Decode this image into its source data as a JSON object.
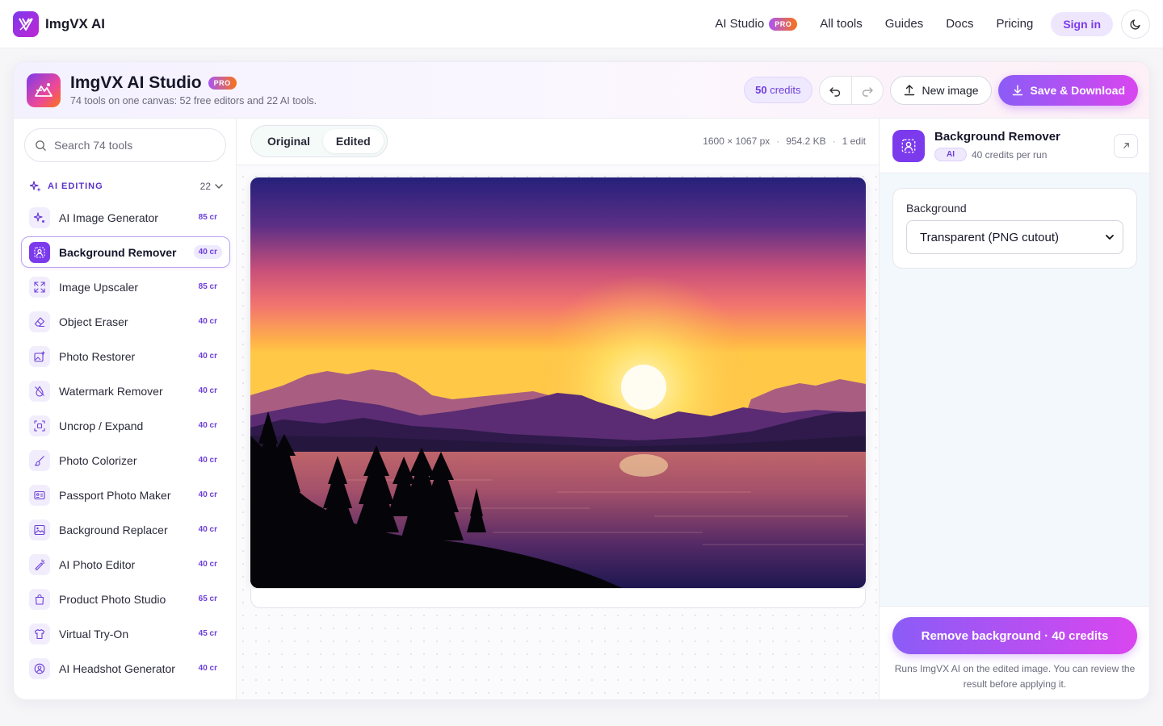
{
  "nav": {
    "brand": "ImgVX AI",
    "links": [
      {
        "label": "AI Studio",
        "badge": "PRO"
      },
      {
        "label": "All tools"
      },
      {
        "label": "Guides"
      },
      {
        "label": "Docs"
      },
      {
        "label": "Pricing"
      }
    ],
    "signin": "Sign in",
    "theme_icon": "moon-icon"
  },
  "studio": {
    "title": "ImgVX AI Studio",
    "badge": "PRO",
    "subtitle": "74 tools on one canvas: 52 free editors and 22 AI tools.",
    "credits_value": "50",
    "credits_label": "credits",
    "new_image": "New image",
    "save": "Save & Download"
  },
  "sidebar": {
    "search_placeholder": "Search 74 tools",
    "section": {
      "title": "AI EDITING",
      "count": "22"
    },
    "tools": [
      {
        "name": "AI Image Generator",
        "cost": "85 cr",
        "icon": "sparkles-icon"
      },
      {
        "name": "Background Remover",
        "cost": "40 cr",
        "icon": "person-cutout-icon",
        "active": true
      },
      {
        "name": "Image Upscaler",
        "cost": "85 cr",
        "icon": "expand-icon"
      },
      {
        "name": "Object Eraser",
        "cost": "40 cr",
        "icon": "eraser-icon"
      },
      {
        "name": "Photo Restorer",
        "cost": "40 cr",
        "icon": "image-plus-icon"
      },
      {
        "name": "Watermark Remover",
        "cost": "40 cr",
        "icon": "droplet-off-icon"
      },
      {
        "name": "Uncrop / Expand",
        "cost": "40 cr",
        "icon": "scan-icon"
      },
      {
        "name": "Photo Colorizer",
        "cost": "40 cr",
        "icon": "brush-icon"
      },
      {
        "name": "Passport Photo Maker",
        "cost": "40 cr",
        "icon": "id-card-icon"
      },
      {
        "name": "Background Replacer",
        "cost": "40 cr",
        "icon": "image-icon"
      },
      {
        "name": "AI Photo Editor",
        "cost": "40 cr",
        "icon": "magic-wand-icon"
      },
      {
        "name": "Product Photo Studio",
        "cost": "65 cr",
        "icon": "shopping-bag-icon"
      },
      {
        "name": "Virtual Try-On",
        "cost": "45 cr",
        "icon": "shirt-icon"
      },
      {
        "name": "AI Headshot Generator",
        "cost": "40 cr",
        "icon": "user-circle-icon"
      }
    ]
  },
  "canvas": {
    "tabs": [
      "Original",
      "Edited"
    ],
    "active_tab": "Edited",
    "dimensions": "1600 × 1067 px",
    "size": "954.2 KB",
    "edits": "1 edit"
  },
  "panel": {
    "title": "Background Remover",
    "chip": "AI",
    "cost": "40 credits per run",
    "field_label": "Background",
    "field_value": "Transparent (PNG cutout)",
    "run_button": "Remove background · 40 credits",
    "note": "Runs ImgVX AI on the edited image. You can review the result before applying it."
  },
  "colors": {
    "accent": "#7c3aed",
    "accent_pink": "#d946ef"
  }
}
